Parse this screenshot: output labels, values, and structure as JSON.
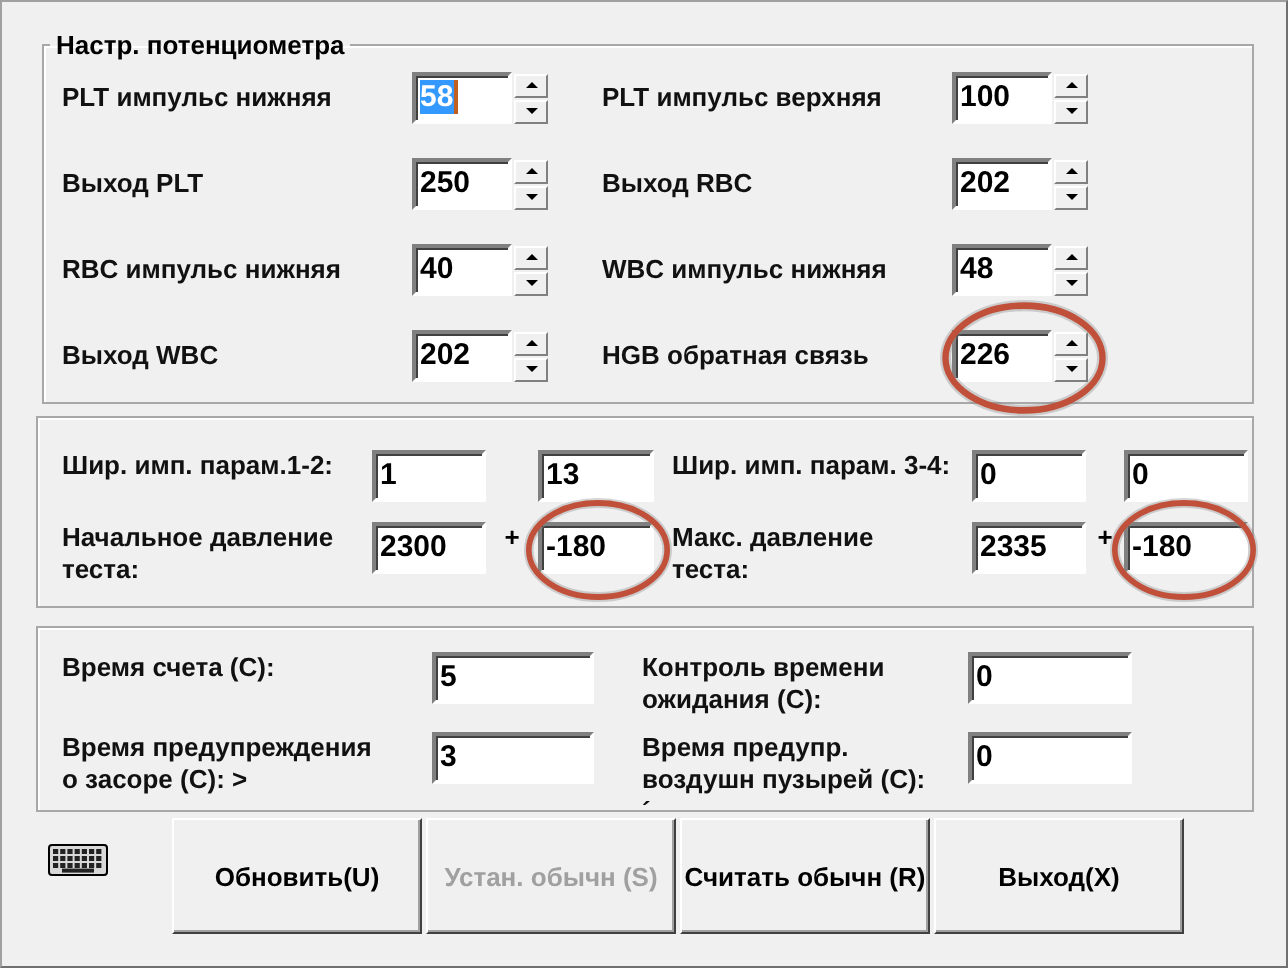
{
  "potentiometer": {
    "title": "Настр. потенциометра",
    "items": [
      {
        "label": "PLT импульс нижняя",
        "value": "58",
        "text_selected": true,
        "highlighted": false
      },
      {
        "label": "PLT импульс верхняя",
        "value": "100",
        "text_selected": false,
        "highlighted": false
      },
      {
        "label": "Выход PLT",
        "value": "250",
        "text_selected": false,
        "highlighted": false
      },
      {
        "label": "Выход RBC",
        "value": "202",
        "text_selected": false,
        "highlighted": false
      },
      {
        "label": "RBC импульс нижняя",
        "value": "40",
        "text_selected": false,
        "highlighted": false
      },
      {
        "label": "WBC импульс нижняя",
        "value": "48",
        "text_selected": false,
        "highlighted": false
      },
      {
        "label": "Выход WBC",
        "value": "202",
        "text_selected": false,
        "highlighted": false
      },
      {
        "label": "HGB обратная связь",
        "value": "226",
        "text_selected": false,
        "highlighted": true
      }
    ]
  },
  "pulse_pressure": {
    "items": [
      {
        "label": "Шир. имп. парам.1-2:",
        "value_1": "1",
        "value_2": "13",
        "highlighted": false
      },
      {
        "label": "Шир. имп. парам. 3-4:",
        "value_1": "0",
        "value_2": "0",
        "highlighted": false
      },
      {
        "label": "Начальное давление\nтеста:",
        "value_1": "2300",
        "separator": "+",
        "value_2": "-180",
        "highlighted": true
      },
      {
        "label": "Макс. давление\nтеста:",
        "value_1": "2335",
        "separator": "+",
        "value_2": "-180",
        "highlighted": true
      }
    ]
  },
  "timing": {
    "items": [
      {
        "label": "Время счета (С):",
        "value": "5"
      },
      {
        "label": "Контроль времени\nожидания (С):",
        "value": "0"
      },
      {
        "label": "Время предупреждения\nо засоре (С): >",
        "value": "3"
      },
      {
        "label": "Время предупр.\nвоздушн пузырей (С):\n´",
        "value": "0"
      }
    ]
  },
  "buttons": [
    {
      "label": "Обновить(U)",
      "disabled": false
    },
    {
      "label": "Устан. обычн (S)",
      "disabled": true
    },
    {
      "label": "Считать обычн (R)",
      "disabled": false
    },
    {
      "label": "Выход(X)",
      "disabled": false
    }
  ]
}
